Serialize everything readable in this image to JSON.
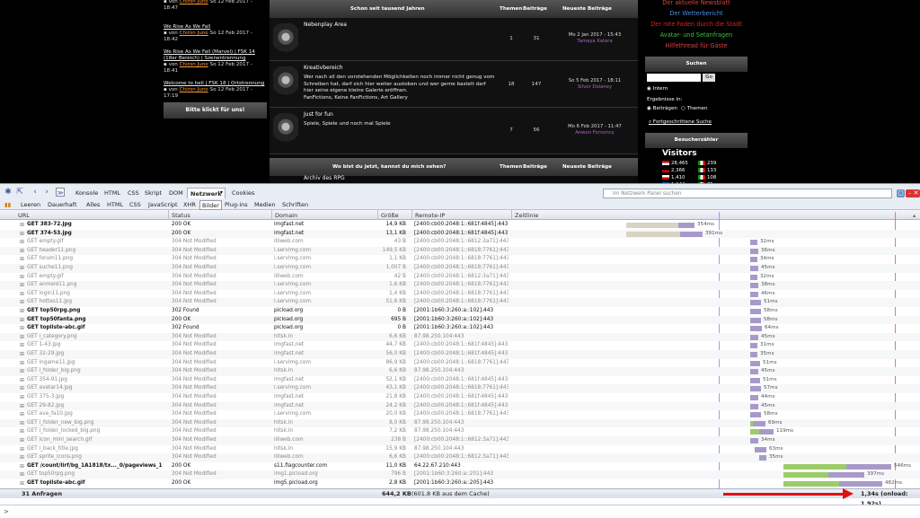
{
  "forum": {
    "left_entries": [
      {
        "title": "», von Chiron Juno So 12 Feb 2017 - 18:47",
        "link": "",
        "user": "Chiron Juno",
        "date": "So 12 Feb 2017 - 18:47",
        "pre": "von"
      },
      {
        "link": "We Rise As We Fall",
        "user": "Chiron Juno",
        "date": "So 12 Feb 2017 - 18:42",
        "pre": "von"
      },
      {
        "link": "We Rise As We Fall (Marvel) | FSK 14 (18er Bereich) | Szenentrennung",
        "user": "Chiron Juno",
        "date": "So 12 Feb 2017 - 18:41",
        "pre": "von"
      },
      {
        "link": "Welcome to hell | FSK 18 | Ortstrennung",
        "user": "Chiron Juno",
        "date": "So 12 Feb 2017 - 17:19",
        "pre": "von"
      }
    ],
    "help_button": "Bitte klickt für uns!",
    "section1_header": "Schon seit tausend Jahren",
    "section2_header": "Wo bist du jetzt, kannst du mich sehen?",
    "col_themen": "Themen",
    "col_beitraege": "Beiträge",
    "col_neueste": "Neueste Beiträge",
    "boards": [
      {
        "title": "Nebenplay Area",
        "desc": "",
        "themen": "1",
        "beitraege": "31",
        "date": "Mo 2 Jan 2017 - 15:43",
        "author": "Tamaya Katara"
      },
      {
        "title": "Kreativbereich",
        "desc": "Wer nach all den vorstehenden Möglichkeiten noch immer nicht genug vom Schreiben hat, darf sich hier weiter austoben und wer gerne bastelt darf hier seine eigene kleine Galerie eröffnen.",
        "sub": "FanFictions, Keine FanFictions, Art Gallery",
        "themen": "18",
        "beitraege": "147",
        "date": "So 5 Feb 2017 - 18:11",
        "author": "Silver Delaney"
      },
      {
        "title": "Just for fun",
        "desc": "Spiele, Spiele und noch mal Spiele",
        "themen": "7",
        "beitraege": "56",
        "date": "Mo 6 Feb 2017 - 11:47",
        "author": "Anwen Fervency"
      }
    ],
    "archive_title": "Archiv des RPG",
    "news": [
      {
        "text": "Der aktuelle Newsblatt",
        "color": "#e04040"
      },
      {
        "text": "Der Wetterbericht",
        "color": "#4c8ce0"
      },
      {
        "text": "Der rote Faden durch die Stadt",
        "color": "#e02020"
      },
      {
        "text": "Avatar- und Setanfragen",
        "color": "#40c040"
      },
      {
        "text": "Hilfethread für Gäste",
        "color": "#e04040"
      }
    ],
    "search_header": "Suchen",
    "go_label": "Go",
    "radio_intern": "Intern",
    "results_in": "Ergebnisse in:",
    "radio_posts": "Beiträgen",
    "radio_topics": "Themen",
    "advanced_search": "Fortgeschrittene Suche",
    "visitors_header": "Besucherzähler",
    "visitors_title": "Visitors",
    "visitor_counts": [
      {
        "a": "28,465",
        "b": "239"
      },
      {
        "a": "2,366",
        "b": "133"
      },
      {
        "a": "1,410",
        "b": "108"
      },
      {
        "a": "1,244",
        "b": "75"
      }
    ]
  },
  "firebug": {
    "tabs": [
      "Konsole",
      "HTML",
      "CSS",
      "Skript",
      "DOM",
      "Netzwerk",
      "Cookies"
    ],
    "active_tab": "Netzwerk",
    "search_placeholder": "Im Netzwerk Panel suchen",
    "filters": [
      "Leeren",
      "Dauerhaft",
      "Alles",
      "HTML",
      "CSS",
      "JavaScript",
      "XHR",
      "Bilder",
      "Plug-ins",
      "Medien",
      "Schriften"
    ],
    "active_filter": "Bilder",
    "columns": {
      "url": "URL",
      "status": "Status",
      "domain": "Domain",
      "size": "Größe",
      "remote": "Remote-IP",
      "timeline": "Zeitlinie"
    },
    "requests": [
      {
        "url": "GET 383-72.jpg",
        "status": "200 OK",
        "domain": "imgfast.net",
        "size": "14,9 KB",
        "ip": "[2400:cb00:2048:1::681f:4845]:443",
        "cached": false,
        "start": 697,
        "wait": 58,
        "recv": 18,
        "time": "354ms"
      },
      {
        "url": "GET 374-53.jpg",
        "status": "200 OK",
        "domain": "imgfast.net",
        "size": "13,1 KB",
        "ip": "[2400:cb00:2048:1::681f:4845]:443",
        "cached": false,
        "start": 697,
        "wait": 60,
        "recv": 25,
        "time": "391ms"
      },
      {
        "url": "GET empty.gif",
        "status": "304 Not Modified",
        "domain": "illiweb.com",
        "size": "43 B",
        "ip": "[2400:cb00:2048:1::6812:3a71]:443",
        "cached": true,
        "start": 835,
        "wait": 0,
        "recv": 8,
        "time": "32ms"
      },
      {
        "url": "GET header11.png",
        "status": "304 Not Modified",
        "domain": "i.servimg.com",
        "size": "149,5 KB",
        "ip": "[2400:cb00:2048:1::6818:7761]:443",
        "cached": true,
        "start": 835,
        "wait": 0,
        "recv": 9,
        "time": "36ms"
      },
      {
        "url": "GET forum11.png",
        "status": "304 Not Modified",
        "domain": "i.servimg.com",
        "size": "1,1 KB",
        "ip": "[2400:cb00:2048:1::6818:7761]:443",
        "cached": true,
        "start": 835,
        "wait": 0,
        "recv": 8,
        "time": "34ms"
      },
      {
        "url": "GET suche11.png",
        "status": "304 Not Modified",
        "domain": "i.servimg.com",
        "size": "1.007 B",
        "ip": "[2400:cb00:2048:1::6818:7761]:443",
        "cached": true,
        "start": 835,
        "wait": 0,
        "recv": 9,
        "time": "45ms"
      },
      {
        "url": "GET empty.gif",
        "status": "304 Not Modified",
        "domain": "illiweb.com",
        "size": "42 B",
        "ip": "[2400:cb00:2048:1::6812:3a71]:443",
        "cached": true,
        "start": 835,
        "wait": 0,
        "recv": 8,
        "time": "32ms"
      },
      {
        "url": "GET anmeld11.png",
        "status": "304 Not Modified",
        "domain": "i.servimg.com",
        "size": "1,6 KB",
        "ip": "[2400:cb00:2048:1::6818:7761]:443",
        "cached": true,
        "start": 835,
        "wait": 0,
        "recv": 9,
        "time": "38ms"
      },
      {
        "url": "GET login11.png",
        "status": "304 Not Modified",
        "domain": "i.servimg.com",
        "size": "1,4 KB",
        "ip": "[2400:cb00:2048:1::6818:7761]:443",
        "cached": true,
        "start": 835,
        "wait": 0,
        "recv": 9,
        "time": "46ms"
      },
      {
        "url": "GET hottes11.jpg",
        "status": "304 Not Modified",
        "domain": "i.servimg.com",
        "size": "51,6 KB",
        "ip": "[2400:cb00:2048:1::6818:7761]:443",
        "cached": true,
        "start": 835,
        "wait": 0,
        "recv": 12,
        "time": "51ms"
      },
      {
        "url": "GET top50rpg.png",
        "status": "302 Found",
        "domain": "picload.org",
        "size": "0 B",
        "ip": "[2001:1b60:3:260:a::102]:443",
        "cached": false,
        "start": 835,
        "wait": 0,
        "recv": 12,
        "time": "58ms"
      },
      {
        "url": "GET top50fanta.png",
        "status": "200 OK",
        "domain": "picload.org",
        "size": "695 B",
        "ip": "[2001:1b60:3:260:a::102]:443",
        "cached": false,
        "start": 835,
        "wait": 0,
        "recv": 12,
        "time": "58ms"
      },
      {
        "url": "GET topliste-abc.gif",
        "status": "302 Found",
        "domain": "picload.org",
        "size": "0 B",
        "ip": "[2001:1b60:3:260:a::102]:443",
        "cached": false,
        "start": 835,
        "wait": 0,
        "recv": 13,
        "time": "64ms"
      },
      {
        "url": "GET i_category.png",
        "status": "304 Not Modified",
        "domain": "hitsk.in",
        "size": "6,6 KB",
        "ip": "87.98.250.104:443",
        "cached": true,
        "start": 835,
        "wait": 0,
        "recv": 9,
        "time": "45ms"
      },
      {
        "url": "GET 1-43.jpg",
        "status": "304 Not Modified",
        "domain": "imgfast.net",
        "size": "44,7 KB",
        "ip": "[2400:cb00:2048:1::681f:4845]:443",
        "cached": true,
        "start": 835,
        "wait": 0,
        "recv": 8,
        "time": "31ms"
      },
      {
        "url": "GET 32-29.jpg",
        "status": "304 Not Modified",
        "domain": "imgfast.net",
        "size": "56,0 KB",
        "ip": "[2400:cb00:2048:1::681f:4845]:443",
        "cached": true,
        "start": 835,
        "wait": 0,
        "recv": 8,
        "time": "35ms"
      },
      {
        "url": "GET ingame11.jpg",
        "status": "304 Not Modified",
        "domain": "i.servimg.com",
        "size": "86,9 KB",
        "ip": "[2400:cb00:2048:1::6818:7761]:443",
        "cached": true,
        "start": 835,
        "wait": 0,
        "recv": 11,
        "time": "51ms"
      },
      {
        "url": "GET i_folder_big.png",
        "status": "304 Not Modified",
        "domain": "hitsk.in",
        "size": "6,6 KB",
        "ip": "87.98.250.104:443",
        "cached": true,
        "start": 835,
        "wait": 0,
        "recv": 9,
        "time": "45ms"
      },
      {
        "url": "GET 354-91.jpg",
        "status": "304 Not Modified",
        "domain": "imgfast.net",
        "size": "52,1 KB",
        "ip": "[2400:cb00:2048:1::681f:4845]:443",
        "cached": true,
        "start": 835,
        "wait": 0,
        "recv": 11,
        "time": "51ms"
      },
      {
        "url": "GET avatar14.jpg",
        "status": "304 Not Modified",
        "domain": "i.servimg.com",
        "size": "43,1 KB",
        "ip": "[2400:cb00:2048:1::6818:7761]:443",
        "cached": true,
        "start": 835,
        "wait": 0,
        "recv": 12,
        "time": "57ms"
      },
      {
        "url": "GET 375-3.jpg",
        "status": "304 Not Modified",
        "domain": "imgfast.net",
        "size": "21,8 KB",
        "ip": "[2400:cb00:2048:1::681f:4845]:443",
        "cached": true,
        "start": 835,
        "wait": 0,
        "recv": 9,
        "time": "44ms"
      },
      {
        "url": "GET 29-82.jpg",
        "status": "304 Not Modified",
        "domain": "imgfast.net",
        "size": "24,2 KB",
        "ip": "[2400:cb00:2048:1::681f:4845]:443",
        "cached": true,
        "start": 835,
        "wait": 0,
        "recv": 9,
        "time": "45ms"
      },
      {
        "url": "GET ava_fa10.jpg",
        "status": "304 Not Modified",
        "domain": "i.servimg.com",
        "size": "20,0 KB",
        "ip": "[2400:cb00:2048:1::6818:7761]:443",
        "cached": true,
        "start": 835,
        "wait": 0,
        "recv": 12,
        "time": "58ms"
      },
      {
        "url": "GET i_folder_new_big.png",
        "status": "304 Not Modified",
        "domain": "hitsk.in",
        "size": "8,0 KB",
        "ip": "87.98.250.104:443",
        "cached": true,
        "start": 835,
        "wait": 3,
        "recv": 14,
        "time": "69ms"
      },
      {
        "url": "GET i_folder_locked_big.png",
        "status": "304 Not Modified",
        "domain": "hitsk.in",
        "size": "7,2 KB",
        "ip": "87.98.250.104:443",
        "cached": true,
        "start": 835,
        "wait": 10,
        "recv": 16,
        "time": "119ms"
      },
      {
        "url": "GET icon_mini_search.gif",
        "status": "304 Not Modified",
        "domain": "illiweb.com",
        "size": "238 B",
        "ip": "[2400:cb00:2048:1::6812:3a71]:443",
        "cached": true,
        "start": 835,
        "wait": 0,
        "recv": 9,
        "time": "34ms"
      },
      {
        "url": "GET i_back_title.jpg",
        "status": "304 Not Modified",
        "domain": "hitsk.in",
        "size": "15,9 KB",
        "ip": "87.98.250.104:443",
        "cached": true,
        "start": 840,
        "wait": 0,
        "recv": 13,
        "time": "63ms"
      },
      {
        "url": "GET sprite_icons.png",
        "status": "304 Not Modified",
        "domain": "illiweb.com",
        "size": "6,6 KB",
        "ip": "[2400:cb00:2048:1::6812:3a71]:443",
        "cached": true,
        "start": 845,
        "wait": 0,
        "recv": 8,
        "time": "35ms"
      },
      {
        "url": "GET /count/lirf/bg_1A1818/tx..._0/pageviews_1/f",
        "status": "200 OK",
        "domain": "s11.flagcounter.com",
        "size": "11,0 KB",
        "ip": "64.22.67.210:443",
        "cached": false,
        "start": 872,
        "wait": 70,
        "recv": 50,
        "time": "546ms"
      },
      {
        "url": "GET top50rpg.png",
        "status": "304 Not Modified",
        "domain": "img1.picload.org",
        "size": "796 B",
        "ip": "[2001:1b60:3:260:a::201]:443",
        "cached": true,
        "start": 872,
        "wait": 50,
        "recv": 40,
        "time": "397ms"
      },
      {
        "url": "GET topliste-abc.gif",
        "status": "200 OK",
        "domain": "img5.picload.org",
        "size": "2,8 KB",
        "ip": "[2001:1b60:3:260:a::205]:443",
        "cached": false,
        "start": 872,
        "wait": 62,
        "recv": 48,
        "time": "482ms"
      }
    ],
    "summary": {
      "count": "31 Anfragen",
      "total_size": "644,2 KB",
      "cache_note": "(601,8 KB aus dem Cache)",
      "total_time": "1,34s (onload: 1,92s)"
    },
    "command_prompt": ">"
  }
}
